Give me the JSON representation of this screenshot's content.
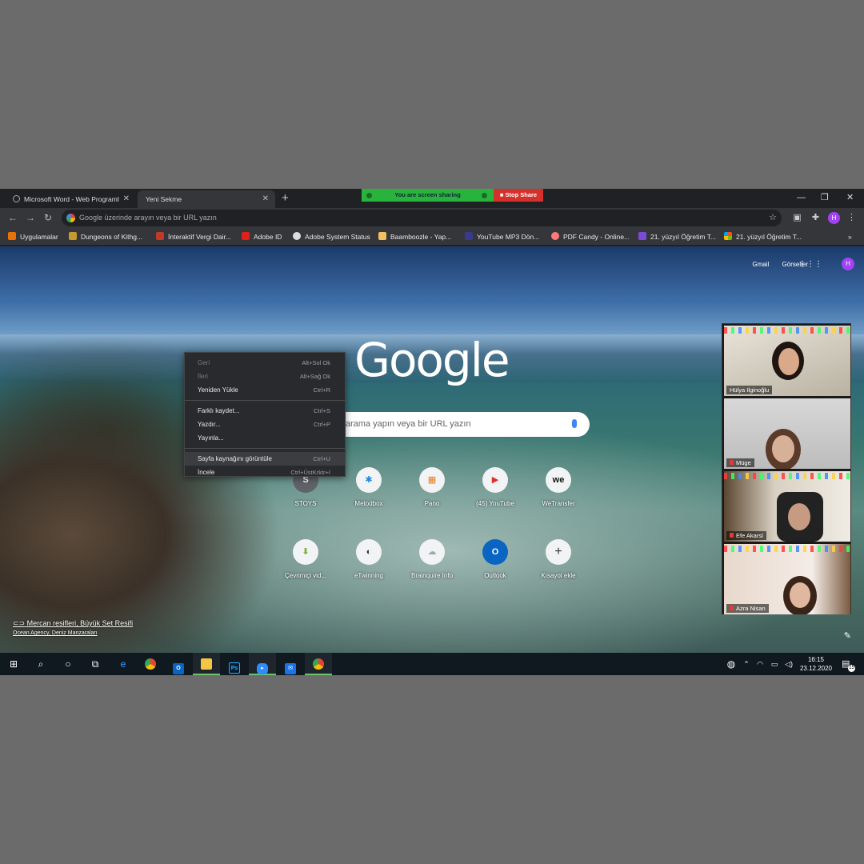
{
  "browser": {
    "tabs": [
      {
        "label": "Microsoft Word - Web Programl"
      },
      {
        "label": "Yeni Sekme"
      }
    ],
    "omnibox_placeholder": "Google üzerinde arayın veya bir URL yazın",
    "profile_initial": "H"
  },
  "zoom_share": {
    "status": "You are screen sharing",
    "stop_label": "Stop Share"
  },
  "bookmarks": [
    {
      "label": "Uygulamalar",
      "color": "#e8710a"
    },
    {
      "label": "Dungeons of Kithg...",
      "color": "#c79a2e"
    },
    {
      "label": "İnteraktif Vergi Dair...",
      "color": "#c0392b"
    },
    {
      "label": "Adobe ID",
      "color": "#e0201a"
    },
    {
      "label": "Adobe System Status",
      "color": "#dddddd"
    },
    {
      "label": "Baamboozle - Yap...",
      "color": "#f0c060"
    },
    {
      "label": "YouTube MP3 Dön...",
      "color": "#3a3a8a"
    },
    {
      "label": "PDF Candy - Online...",
      "color": "#ff7b7b"
    },
    {
      "label": "21. yüzyıl Öğretim T...",
      "color": "#7b4bd6"
    },
    {
      "label": "21. yüzyıl Öğretim T...",
      "color": "#f25022"
    }
  ],
  "ntp": {
    "links": [
      "Gmail",
      "Görseller"
    ],
    "avatar": "H",
    "logo": "Google",
    "search_placeholder": "Google'da arama yapın veya bir URL yazın",
    "shortcuts_row1": [
      {
        "label": "STOYS",
        "icon": "S"
      },
      {
        "label": "Metodbox",
        "icon": "✱"
      },
      {
        "label": "Pano",
        "icon": "▦"
      },
      {
        "label": "(45) YouTube",
        "icon": "▶"
      },
      {
        "label": "WeTransfer",
        "icon": "we"
      }
    ],
    "shortcuts_row2": [
      {
        "label": "Çevrimiçi vid...",
        "icon": "⬇"
      },
      {
        "label": "eTwinning",
        "icon": "◐"
      },
      {
        "label": "Brainquire Info",
        "icon": "☁"
      },
      {
        "label": "Outlook",
        "icon": "O"
      },
      {
        "label": "Kısayol ekle",
        "icon": "+"
      }
    ],
    "credit_title": "Mercan resifleri, Büyük Set Resifi",
    "credit_sub": "Ocean Agency, Deniz Manzaraları"
  },
  "context_menu": [
    {
      "label": "Geri",
      "shortcut": "Alt+Sol Ok",
      "disabled": true
    },
    {
      "label": "İleri",
      "shortcut": "Alt+Sağ Ok",
      "disabled": true
    },
    {
      "label": "Yeniden Yükle",
      "shortcut": "Ctrl+R"
    },
    {
      "label": "Farklı kaydet...",
      "shortcut": "Ctrl+S"
    },
    {
      "label": "Yazdır...",
      "shortcut": "Ctrl+P"
    },
    {
      "label": "Yayınla...",
      "shortcut": ""
    },
    {
      "label": "Sayfa kaynağını görüntüle",
      "shortcut": "Ctrl+U"
    },
    {
      "label": "İncele",
      "shortcut": "Ctrl+ÜstKrktr+I"
    }
  ],
  "participants": [
    {
      "name": "Hülya Ilginoğlu",
      "muted": false
    },
    {
      "name": "Müge",
      "muted": true
    },
    {
      "name": "Efe Akarsl",
      "muted": true
    },
    {
      "name": "Azra Nisan",
      "muted": true
    }
  ],
  "taskbar": {
    "time": "16:15",
    "date": "23.12.2020",
    "notifications": "15"
  }
}
